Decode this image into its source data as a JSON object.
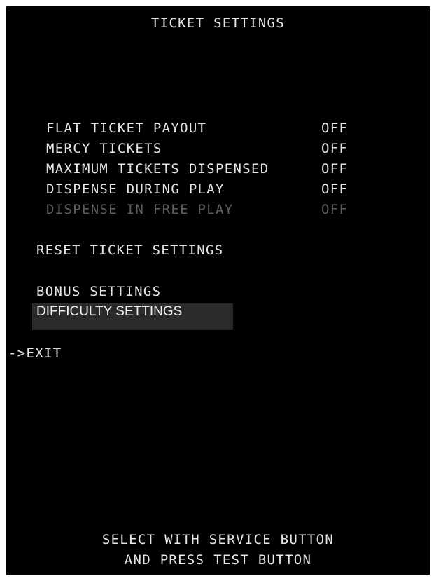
{
  "title": "TICKET SETTINGS",
  "settings": [
    {
      "label": "FLAT TICKET PAYOUT",
      "value": "OFF",
      "enabled": true
    },
    {
      "label": "MERCY TICKETS",
      "value": "OFF",
      "enabled": true
    },
    {
      "label": "MAXIMUM TICKETS DISPENSED",
      "value": "OFF",
      "enabled": true
    },
    {
      "label": "DISPENSE DURING PLAY",
      "value": "OFF",
      "enabled": true
    },
    {
      "label": "DISPENSE IN FREE PLAY",
      "value": "OFF",
      "enabled": false
    }
  ],
  "menu": {
    "reset": "RESET TICKET SETTINGS",
    "bonus": "BONUS SETTINGS",
    "difficulty": "DIFFICULTY SETTINGS",
    "exit": "->EXIT"
  },
  "footer": {
    "line1": "SELECT WITH SERVICE BUTTON",
    "line2": "AND PRESS TEST BUTTON"
  },
  "colors": {
    "background": "#000000",
    "text": "#e6e6e6",
    "disabled_text": "#5e5e5e",
    "highlight": "#2b2b2b"
  }
}
